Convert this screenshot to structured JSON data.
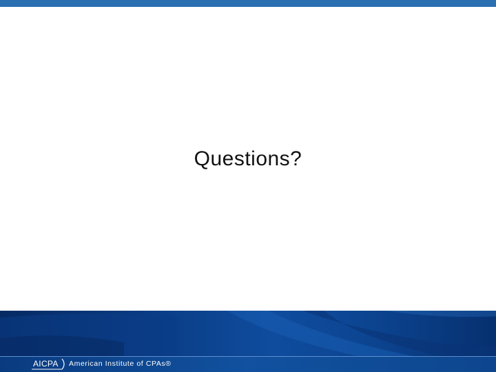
{
  "slide": {
    "title": "Questions?"
  },
  "footer": {
    "logo_text": "AICPA",
    "org_name": "American Institute of CPAs®"
  },
  "colors": {
    "top_bar": "#2a6fb0",
    "banner_dark": "#062a63",
    "banner_mid": "#0f4c9e",
    "footer_text": "#ffffff"
  }
}
